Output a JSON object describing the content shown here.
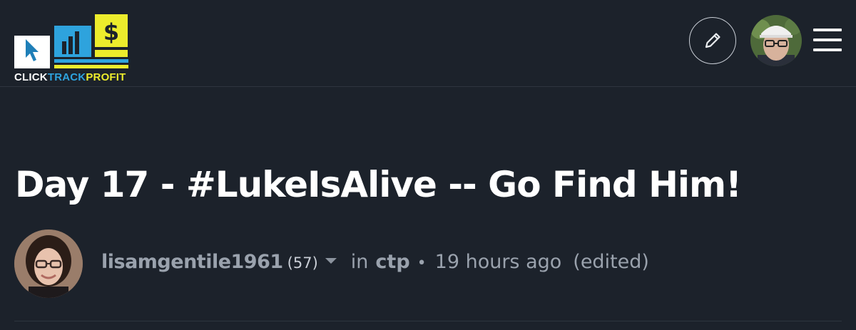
{
  "header": {
    "logo": {
      "text_part1": "CLICK",
      "text_part2": "TRACK",
      "text_part3": "PROFIT",
      "colors": {
        "blue": "#2ea3dd",
        "yellow": "#ecec2c",
        "white": "#ffffff"
      }
    },
    "edit_icon": "pencil-icon",
    "menu_icon": "hamburger-menu-icon"
  },
  "post": {
    "title": "Day 17 - #LukeIsAlive -- Go Find Him!",
    "author": "lisamgentile1961",
    "reputation": "(57)",
    "in_label": "in",
    "community": "ctp",
    "separator": "•",
    "time_ago": "19 hours ago",
    "edited_label": "(edited)"
  },
  "theme": {
    "background": "#1c222b",
    "muted_text": "#9aa2ad"
  }
}
